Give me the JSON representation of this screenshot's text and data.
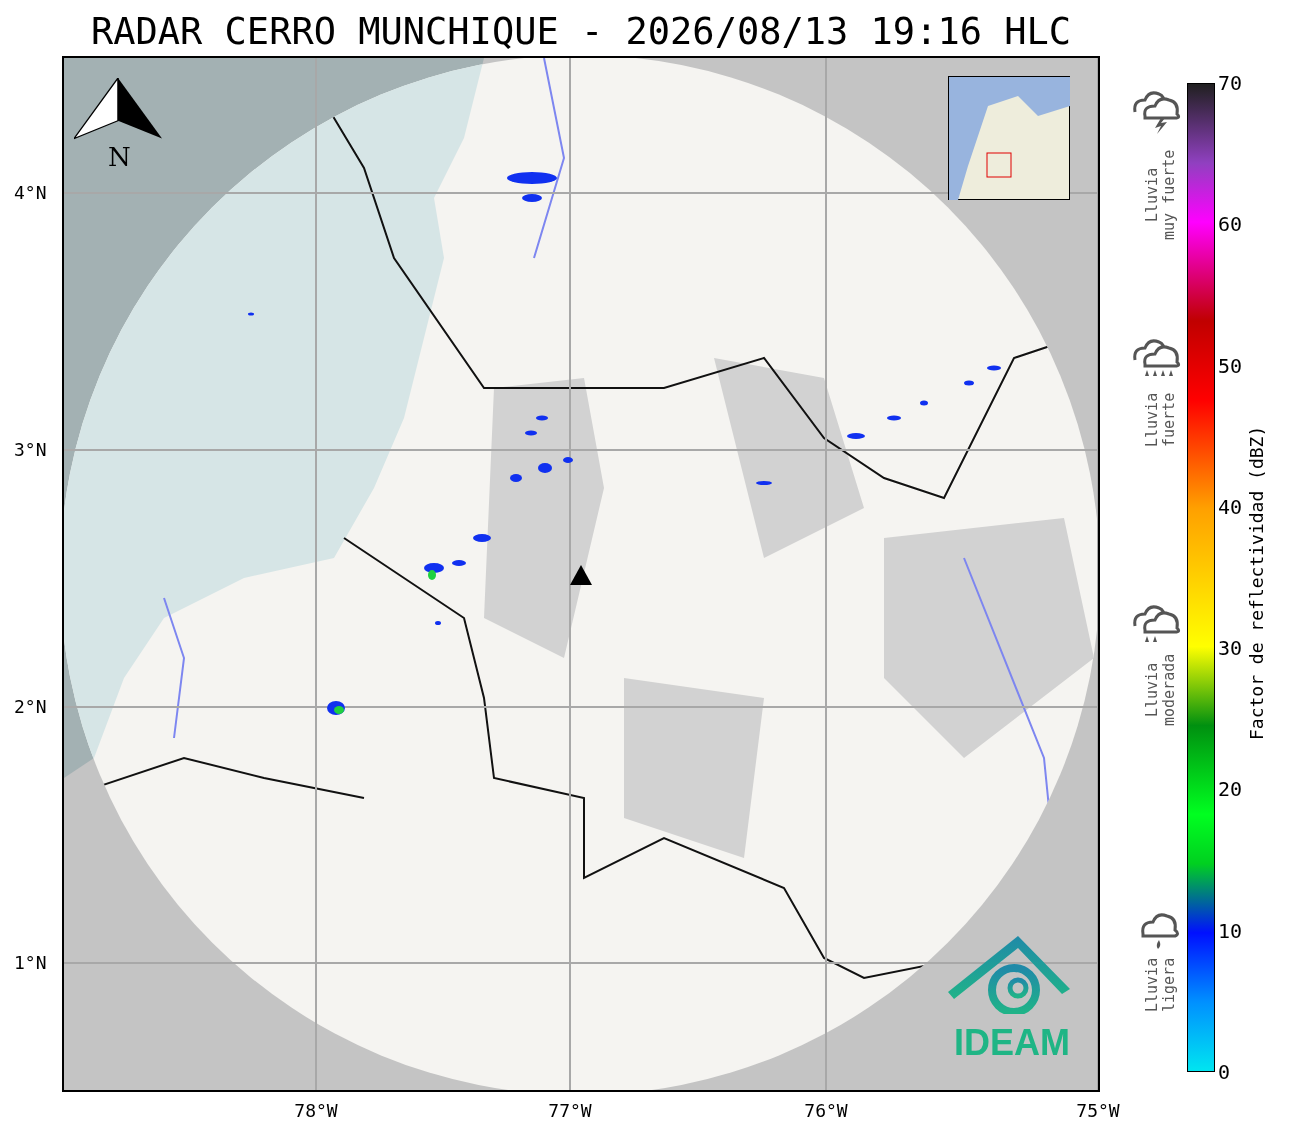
{
  "title": "RADAR CERRO MUNCHIQUE - 2026/08/13 19:16 HLC",
  "map": {
    "north_label": "N",
    "logo_text": "IDEAM",
    "y_ticks": [
      "4°N",
      "3°N",
      "2°N",
      "1°N"
    ],
    "x_ticks": [
      "78°W",
      "77°W",
      "76°W",
      "75°W"
    ]
  },
  "colorbar": {
    "label": "Factor de reflectividad (dBZ)",
    "ticks": [
      "70",
      "60",
      "50",
      "40",
      "30",
      "20",
      "10",
      "0"
    ]
  },
  "legend": [
    {
      "kind": "storm",
      "line1": "Lluvia",
      "line2": "muy fuerte"
    },
    {
      "kind": "heavy",
      "line1": "Lluvia",
      "line2": "fuerte"
    },
    {
      "kind": "moderate",
      "line1": "Lluvia",
      "line2": "moderada"
    },
    {
      "kind": "light",
      "line1": "Lluvia",
      "line2": "ligera"
    }
  ]
}
